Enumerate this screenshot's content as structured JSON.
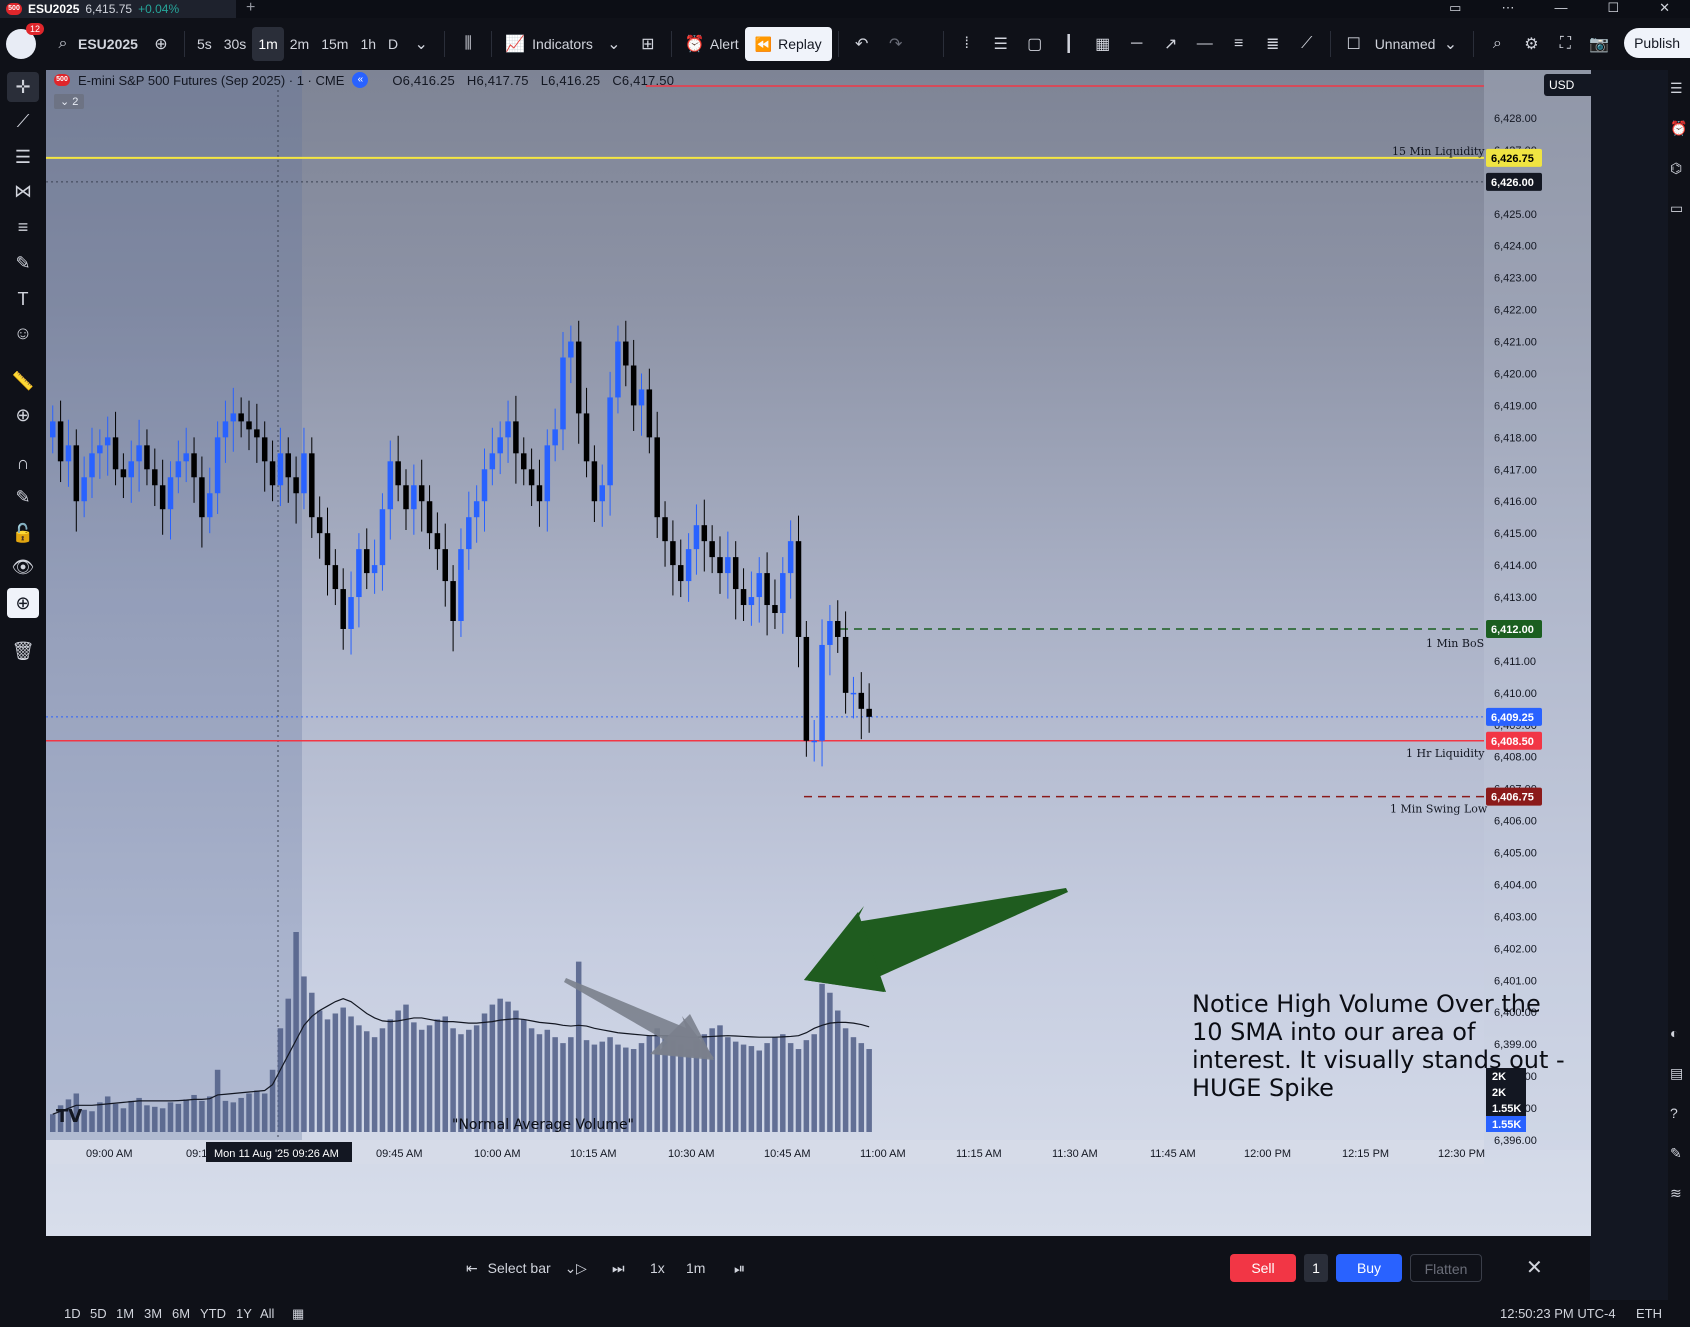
{
  "tab": {
    "logo": "500",
    "symbol": "ESU2025",
    "price": "6,415.75",
    "change": "+0.04%"
  },
  "window": {
    "plus": "+"
  },
  "toolbar": {
    "badge": "12",
    "symbol": "ESU2025",
    "intervals": [
      "5s",
      "30s",
      "1m",
      "2m",
      "15m",
      "1h",
      "D"
    ],
    "active_interval": "1m",
    "indicators": "Indicators",
    "alert": "Alert",
    "replay": "Replay",
    "layout_name": "Unnamed",
    "publish": "Publish"
  },
  "legend": {
    "logo": "500",
    "title": "E-mini S&P 500 Futures (Sep 2025) · 1 · CME",
    "open": "O6,416.25",
    "high": "H6,417.75",
    "low": "L6,416.25",
    "close": "C6,417.50",
    "collapse": "⌄ 2"
  },
  "currency": "USD",
  "price_axis": {
    "ticks": [
      "6,428.00",
      "6,427.00",
      "6,426.00",
      "6,425.00",
      "6,424.00",
      "6,423.00",
      "6,422.00",
      "6,421.00",
      "6,420.00",
      "6,419.00",
      "6,418.00",
      "6,417.00",
      "6,416.00",
      "6,415.00",
      "6,414.00",
      "6,413.00",
      "6,412.00",
      "6,411.00",
      "6,410.00",
      "6,409.00",
      "6,408.00",
      "6,407.00",
      "6,406.00",
      "6,405.00",
      "6,404.00",
      "6,403.00",
      "6,402.00",
      "6,401.00",
      "6,400.00",
      "6,399.00",
      "6,398.00",
      "6,397.00",
      "6,396.00"
    ],
    "markers": [
      {
        "label": "6,426.75",
        "color": "#f0e442",
        "text_color": "#000000"
      },
      {
        "label": "6,426.00",
        "color": "#131722",
        "text_color": "#ffffff"
      },
      {
        "label": "6,412.00",
        "color": "#1b5e20",
        "text_color": "#ffffff"
      },
      {
        "label": "6,409.25",
        "color": "#2962ff",
        "text_color": "#ffffff"
      },
      {
        "label": "6,408.50",
        "color": "#f23645",
        "text_color": "#ffffff"
      },
      {
        "label": "6,406.75",
        "color": "#8b1a1a",
        "text_color": "#ffffff"
      }
    ],
    "volume_markers": [
      "2K",
      "2K",
      "1.55K",
      "1.55K"
    ]
  },
  "levels": [
    {
      "name": "15 Min Liquidity",
      "price": 6426.75,
      "color": "#f5e642"
    },
    {
      "name": "1 Min BoS",
      "price": 6412.0,
      "color": "#1b5e20"
    },
    {
      "name": "1 Hr Liquidity",
      "price": 6408.5,
      "color": "#f23645"
    },
    {
      "name": "1 Min Swing Low",
      "price": 6406.75,
      "color": "#8b1a1a"
    }
  ],
  "time_axis": {
    "labels": [
      "09:00 AM",
      "09:1",
      "09:45 AM",
      "10:00 AM",
      "10:15 AM",
      "10:30 AM",
      "10:45 AM",
      "11:00 AM",
      "11:15 AM",
      "11:30 AM",
      "11:45 AM",
      "12:00 PM",
      "12:15 PM",
      "12:30 PM"
    ],
    "cursor_label": "Mon 11 Aug '25   09:26 AM"
  },
  "annotations": {
    "note": "Notice High Volume Over the 10 SMA into our area of interest. It visually stands out - HUGE Spike",
    "quote": "\"Normal Average Volume\""
  },
  "tv_logo": "TV",
  "bottom": {
    "select_bar": "Select bar",
    "speed": "1x",
    "interval": "1m",
    "sell": "Sell",
    "qty": "1",
    "buy": "Buy",
    "flatten": "Flatten"
  },
  "footer": {
    "ranges": [
      "1D",
      "5D",
      "1M",
      "3M",
      "6M",
      "YTD",
      "1Y",
      "All"
    ],
    "clock": "12:50:23 PM UTC-4",
    "session": "ETH"
  },
  "chart_data": {
    "type": "candlestick",
    "title": "E-mini S&P 500 Futures (Sep 2025) · 1 · CME",
    "ylim": [
      6396,
      6428.5
    ],
    "up_color": "#2962ff",
    "down_color": "#000000",
    "close": [
      6418.5,
      6417.25,
      6417.75,
      6416.0,
      6416.75,
      6417.5,
      6417.75,
      6418.0,
      6417.0,
      6416.75,
      6417.25,
      6417.75,
      6417.0,
      6416.5,
      6415.75,
      6416.75,
      6417.25,
      6417.5,
      6416.75,
      6415.5,
      6416.25,
      6418.0,
      6418.5,
      6418.75,
      6418.5,
      6418.25,
      6418.0,
      6417.25,
      6416.5,
      6417.5,
      6416.75,
      6416.25,
      6417.5,
      6415.5,
      6415.0,
      6414.0,
      6413.25,
      6412.0,
      6413.0,
      6414.5,
      6413.75,
      6414.0,
      6415.75,
      6417.25,
      6416.5,
      6415.75,
      6416.5,
      6416.0,
      6415.0,
      6414.5,
      6413.5,
      6412.25,
      6414.5,
      6415.5,
      6416.0,
      6417.0,
      6417.5,
      6418.0,
      6418.5,
      6417.5,
      6417.0,
      6416.5,
      6416.0,
      6417.75,
      6418.25,
      6420.5,
      6421.0,
      6418.75,
      6417.25,
      6416.0,
      6416.5,
      6419.25,
      6421.0,
      6420.25,
      6419.0,
      6419.5,
      6418.0,
      6415.5,
      6414.75,
      6414.0,
      6413.5,
      6414.5,
      6415.25,
      6414.75,
      6414.25,
      6413.75,
      6414.25,
      6413.25,
      6412.75,
      6413.0,
      6413.75,
      6412.75,
      6412.5,
      6413.75,
      6414.75,
      6411.75,
      6408.5,
      6408.5,
      6411.5,
      6412.25,
      6411.75,
      6410.0,
      6410.0,
      6409.5,
      6409.25
    ],
    "volume": [
      120,
      180,
      220,
      260,
      150,
      140,
      200,
      240,
      190,
      160,
      210,
      230,
      180,
      170,
      160,
      200,
      190,
      220,
      250,
      210,
      240,
      420,
      210,
      200,
      230,
      260,
      280,
      260,
      420,
      700,
      900,
      1350,
      1050,
      940,
      820,
      760,
      800,
      840,
      780,
      720,
      680,
      640,
      700,
      760,
      820,
      860,
      740,
      690,
      720,
      760,
      780,
      700,
      660,
      690,
      720,
      800,
      860,
      900,
      880,
      820,
      760,
      700,
      660,
      690,
      640,
      600,
      640,
      1150,
      620,
      590,
      610,
      640,
      590,
      570,
      560,
      600,
      650,
      700,
      650,
      620,
      590,
      560,
      620,
      660,
      700,
      720,
      640,
      610,
      590,
      580,
      550,
      600,
      640,
      660,
      600,
      560,
      620,
      660,
      1000,
      940,
      820,
      700,
      640,
      600,
      560
    ],
    "sma10": [
      120,
      140,
      160,
      180,
      180,
      180,
      185,
      190,
      195,
      200,
      205,
      210,
      210,
      210,
      210,
      210,
      212,
      215,
      220,
      220,
      225,
      250,
      255,
      260,
      265,
      270,
      275,
      280,
      320,
      420,
      520,
      620,
      720,
      780,
      820,
      850,
      880,
      900,
      880,
      840,
      800,
      770,
      750,
      745,
      750,
      760,
      770,
      770,
      760,
      750,
      745,
      745,
      740,
      735,
      735,
      740,
      745,
      755,
      760,
      765,
      760,
      750,
      740,
      735,
      730,
      720,
      715,
      720,
      715,
      700,
      690,
      680,
      670,
      665,
      660,
      655,
      650,
      650,
      650,
      648,
      645,
      640,
      640,
      642,
      645,
      648,
      650,
      648,
      645,
      642,
      640,
      640,
      640,
      642,
      645,
      650,
      670,
      700,
      720,
      735,
      740,
      740,
      735,
      725,
      710
    ]
  }
}
